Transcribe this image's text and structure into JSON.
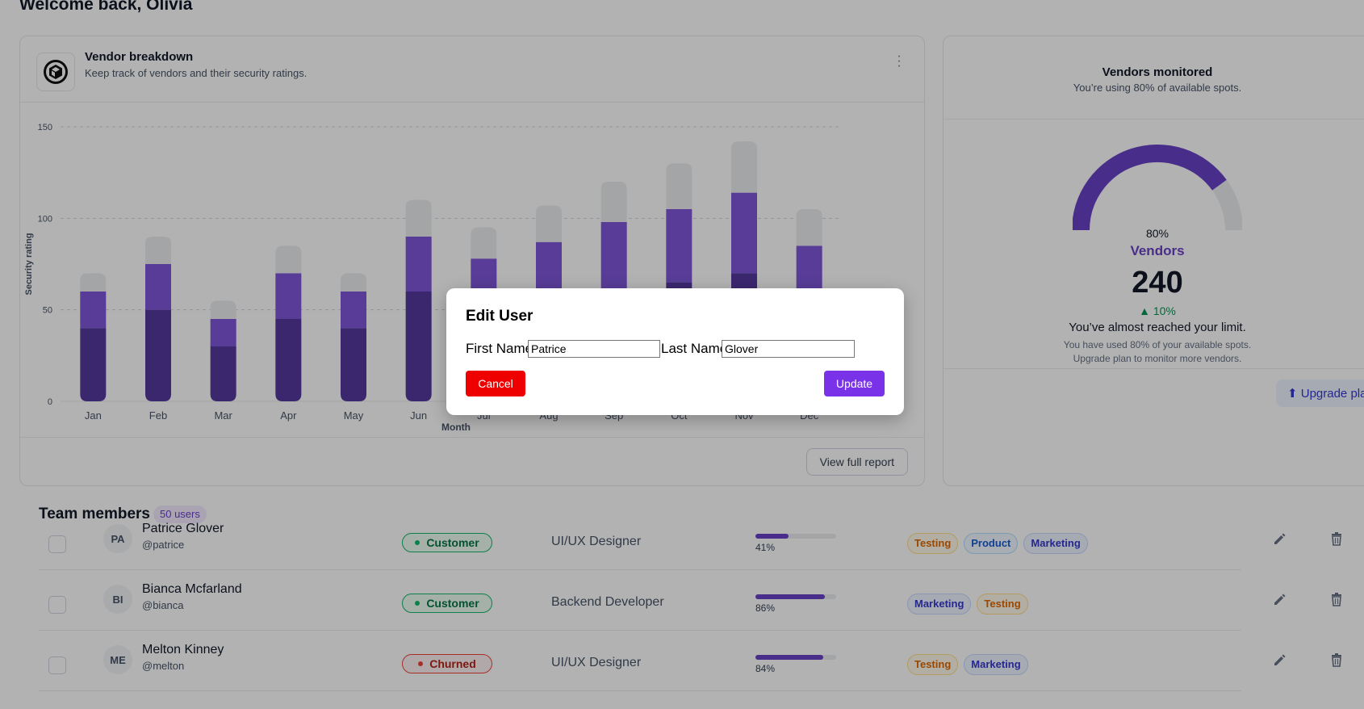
{
  "header": {
    "welcome": "Welcome back, Olivia"
  },
  "vendor_card": {
    "title": "Vendor breakdown",
    "subtitle": "Keep track of vendors and their security ratings.",
    "logo_icon": "cube-logo-icon",
    "menu_icon": "more-vertical-icon",
    "view_report_label": "View full report"
  },
  "chart_data": {
    "type": "bar",
    "stacked": true,
    "categories": [
      "Jan",
      "Feb",
      "Mar",
      "Apr",
      "May",
      "Jun",
      "Jul",
      "Aug",
      "Sep",
      "Oct",
      "Nov",
      "Dec"
    ],
    "series": [
      {
        "values": [
          40,
          50,
          30,
          45,
          40,
          60,
          50,
          55,
          60,
          65,
          70,
          60
        ],
        "color": "#53389e"
      },
      {
        "values": [
          20,
          25,
          15,
          25,
          20,
          30,
          28,
          32,
          38,
          40,
          44,
          25
        ],
        "color": "#7f56d9"
      },
      {
        "values": [
          10,
          15,
          10,
          15,
          10,
          20,
          17,
          20,
          22,
          25,
          28,
          20
        ],
        "color": "#eaecf0"
      }
    ],
    "xlabel": "Month",
    "ylabel": "Security rating",
    "ylim": [
      0,
      150
    ],
    "yticks": [
      0,
      50,
      100,
      150
    ],
    "grid": true
  },
  "monitor_card": {
    "title": "Vendors monitored",
    "subtitle": "You’re using 80% of available spots.",
    "gauge_value": 0.8,
    "gauge_percent": "80%",
    "gauge_label": "Vendors",
    "count": "240",
    "change": "▲ 10%",
    "message": "You’ve almost reached your limit.",
    "note_line1": "You have used 80% of your available spots.",
    "note_line2": "Upgrade plan to monitor more vendors.",
    "upgrade_label": "⬆ Upgrade plan",
    "accent": "#6941c6"
  },
  "team": {
    "title": "Team members",
    "badge": "50 users",
    "rows": [
      {
        "initials": "PA",
        "name": "Patrice Glover",
        "handle": "@patrice",
        "status": "Customer",
        "role": "UI/UX Designer",
        "progress": 41,
        "progress_label": "41%",
        "tags": [
          "Testing",
          "Product",
          "Marketing"
        ]
      },
      {
        "initials": "BI",
        "name": "Bianca Mcfarland",
        "handle": "@bianca",
        "status": "Customer",
        "role": "Backend Developer",
        "progress": 86,
        "progress_label": "86%",
        "tags": [
          "Marketing",
          "Testing"
        ]
      },
      {
        "initials": "ME",
        "name": "Melton Kinney",
        "handle": "@melton",
        "status": "Churned",
        "role": "UI/UX Designer",
        "progress": 84,
        "progress_label": "84%",
        "tags": [
          "Testing",
          "Marketing"
        ]
      }
    ]
  },
  "modal": {
    "title": "Edit User",
    "first_name_label": "First Name:",
    "first_name_value": "Patrice",
    "last_name_label": "Last Name:",
    "last_name_value": "Glover",
    "cancel_label": "Cancel",
    "update_label": "Update"
  }
}
